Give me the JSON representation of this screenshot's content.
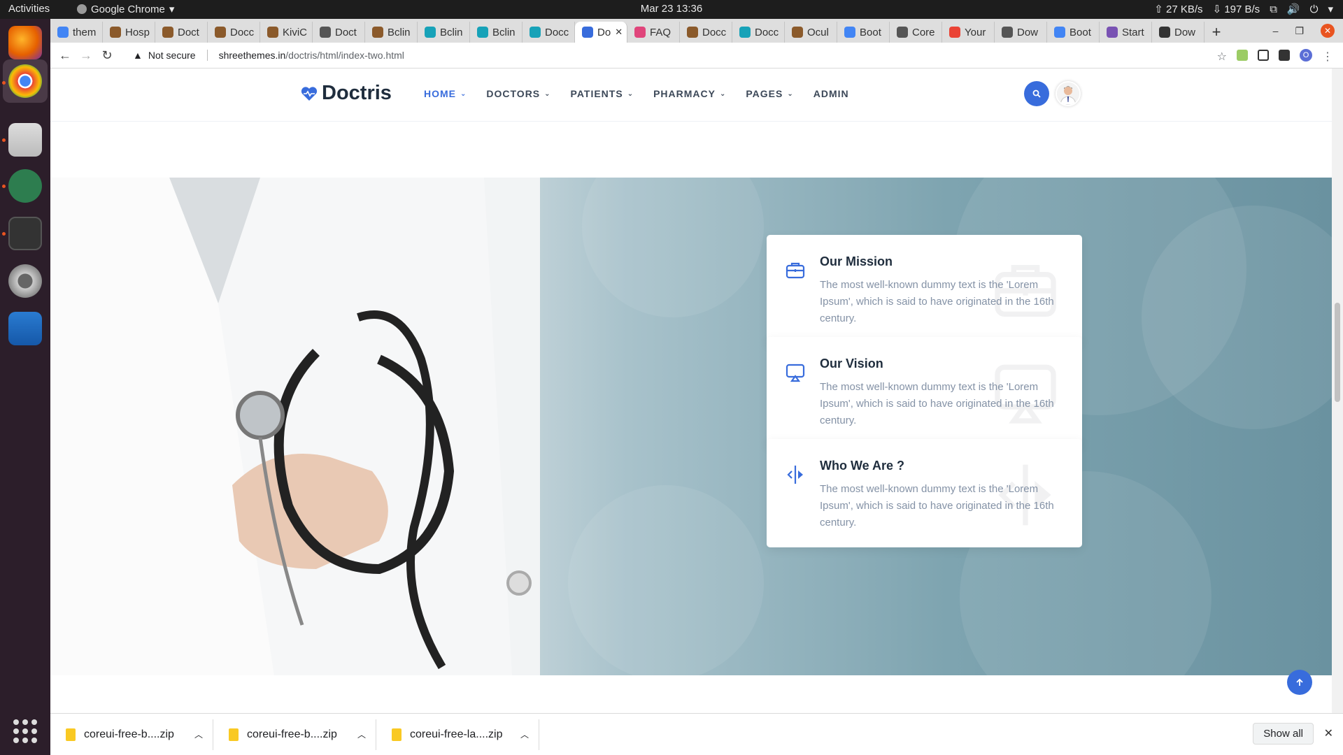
{
  "system": {
    "activities": "Activities",
    "app_name": "Google Chrome",
    "clock": "Mar 23  13:36",
    "net_up": "27 KB/s",
    "net_down": "197 B/s"
  },
  "tabs": [
    {
      "label": "them",
      "color": "#4285f4"
    },
    {
      "label": "Hosp",
      "color": "#8b5a2b"
    },
    {
      "label": "Doct",
      "color": "#8b5a2b"
    },
    {
      "label": "Docc",
      "color": "#8b5a2b"
    },
    {
      "label": "KiviC",
      "color": "#8b5a2b"
    },
    {
      "label": "Doct",
      "color": "#555555"
    },
    {
      "label": "Bclin",
      "color": "#8b5a2b"
    },
    {
      "label": "Bclin",
      "color": "#17a2b8"
    },
    {
      "label": "Bclin",
      "color": "#17a2b8"
    },
    {
      "label": "Docc",
      "color": "#17a2b8"
    },
    {
      "label": "Do",
      "color": "#386cdc",
      "active": true
    },
    {
      "label": "FAQ",
      "color": "#e0457b"
    },
    {
      "label": "Docc",
      "color": "#8b5a2b"
    },
    {
      "label": "Docc",
      "color": "#17a2b8"
    },
    {
      "label": "Ocul",
      "color": "#8b5a2b"
    },
    {
      "label": "Boot",
      "color": "#4285f4"
    },
    {
      "label": "Core",
      "color": "#555555"
    },
    {
      "label": "Your",
      "color": "#ea4335"
    },
    {
      "label": "Dow",
      "color": "#555555"
    },
    {
      "label": "Boot",
      "color": "#4285f4"
    },
    {
      "label": "Start",
      "color": "#7952b3"
    },
    {
      "label": "Dow",
      "color": "#333333"
    }
  ],
  "omnibar": {
    "security": "Not secure",
    "host": "shreethemes.in",
    "path": "/doctris/html/index-two.html",
    "profile_initial": "O"
  },
  "site": {
    "logo": "Doctris",
    "menu": [
      {
        "label": "HOME",
        "active": true,
        "has_children": true
      },
      {
        "label": "DOCTORS",
        "has_children": true
      },
      {
        "label": "PATIENTS",
        "has_children": true
      },
      {
        "label": "PHARMACY",
        "has_children": true
      },
      {
        "label": "PAGES",
        "has_children": true
      },
      {
        "label": "ADMIN",
        "has_children": false
      }
    ],
    "accent": "#386cdc"
  },
  "cards": [
    {
      "title": "Our Mission",
      "text": "The most well-known dummy text is the 'Lorem Ipsum', which is said to have originated in the 16th century.",
      "icon": "briefcase-icon"
    },
    {
      "title": "Our Vision",
      "text": "The most well-known dummy text is the 'Lorem Ipsum', which is said to have originated in the 16th century.",
      "icon": "airplay-icon"
    },
    {
      "title": "Who We Are ?",
      "text": "The most well-known dummy text is the 'Lorem Ipsum', which is said to have originated in the 16th century.",
      "icon": "code-fork-icon"
    }
  ],
  "downloads": [
    {
      "name": "coreui-free-b....zip"
    },
    {
      "name": "coreui-free-b....zip"
    },
    {
      "name": "coreui-free-la....zip"
    }
  ],
  "shelf": {
    "show_all": "Show all"
  }
}
